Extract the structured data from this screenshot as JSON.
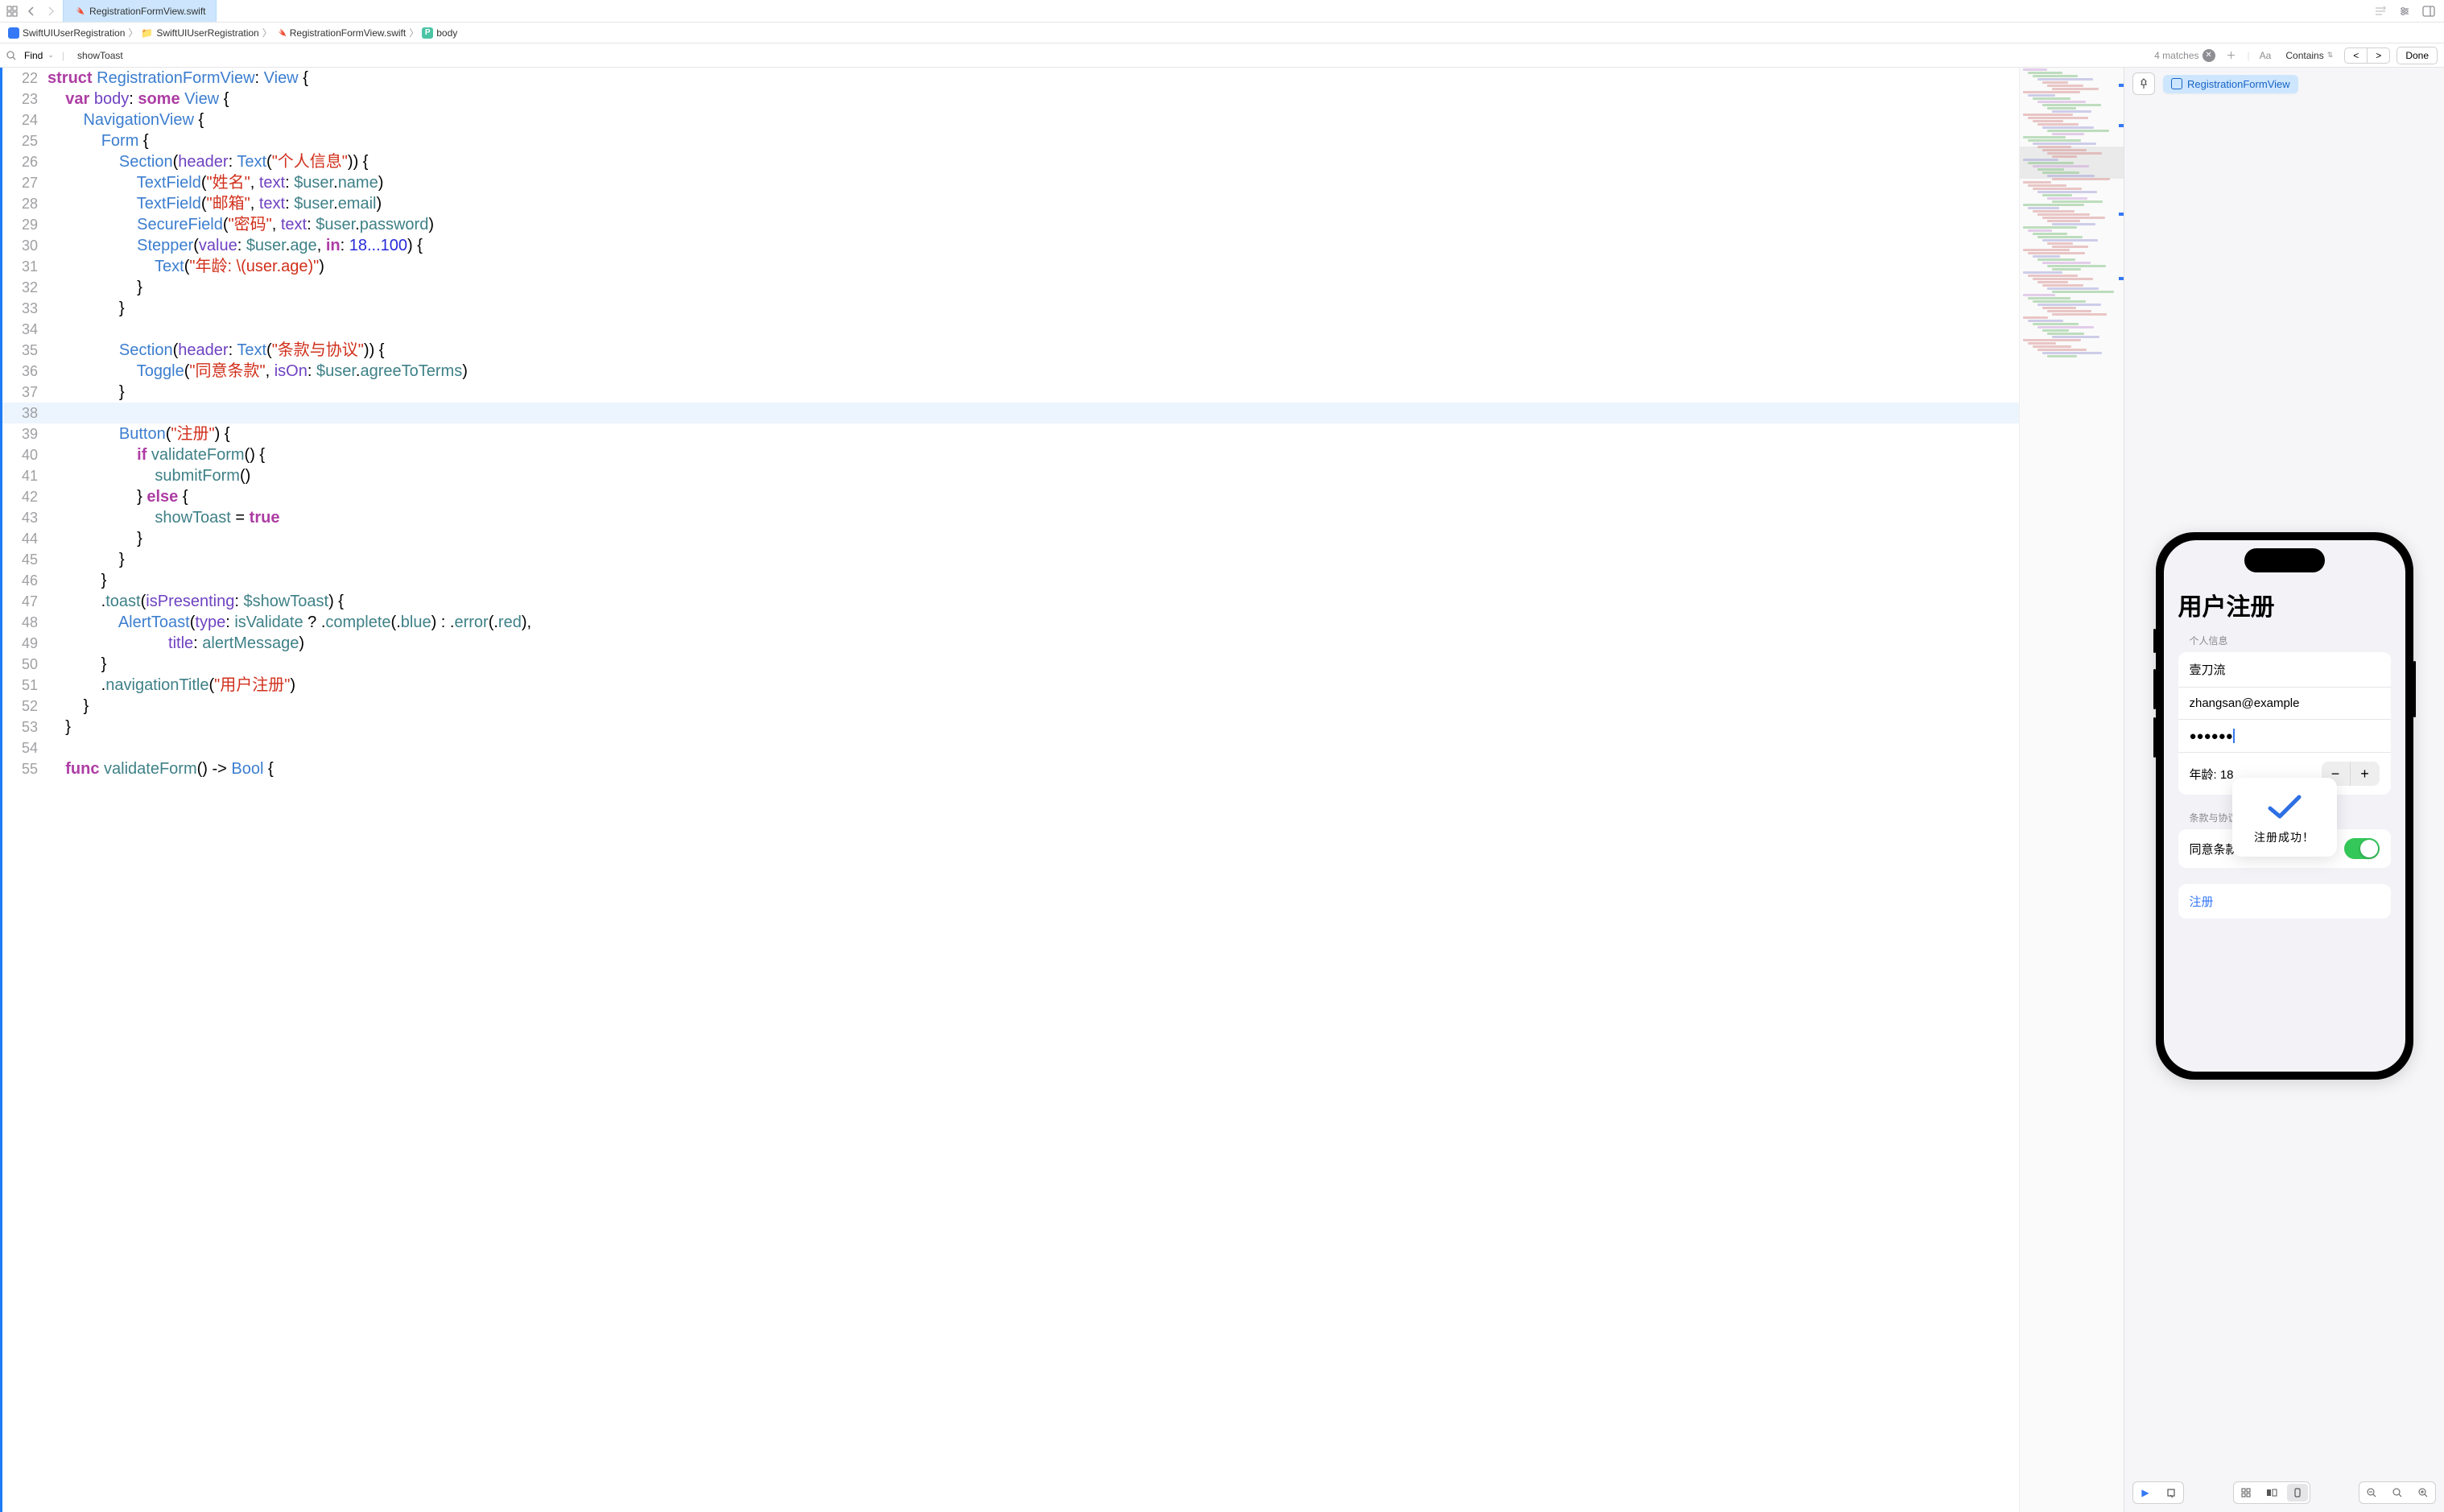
{
  "tab": {
    "filename": "RegistrationFormView.swift"
  },
  "breadcrumb": {
    "project": "SwiftUIUserRegistration",
    "folder": "SwiftUIUserRegistration",
    "file": "RegistrationFormView.swift",
    "symbol": "body",
    "symbol_badge": "P"
  },
  "find": {
    "mode": "Find",
    "term": "showToast",
    "matches": "4 matches",
    "contains": "Contains",
    "case_label": "Aa",
    "done": "Done"
  },
  "code_lines": [
    {
      "n": 22,
      "t": "struct RegistrationFormView: View {"
    },
    {
      "n": 23,
      "t": "    var body: some View {"
    },
    {
      "n": 24,
      "t": "        NavigationView {"
    },
    {
      "n": 25,
      "t": "            Form {"
    },
    {
      "n": 26,
      "t": "                Section(header: Text(\"个人信息\")) {"
    },
    {
      "n": 27,
      "t": "                    TextField(\"姓名\", text: $user.name)"
    },
    {
      "n": 28,
      "t": "                    TextField(\"邮箱\", text: $user.email)"
    },
    {
      "n": 29,
      "t": "                    SecureField(\"密码\", text: $user.password)"
    },
    {
      "n": 30,
      "t": "                    Stepper(value: $user.age, in: 18...100) {"
    },
    {
      "n": 31,
      "t": "                        Text(\"年龄: \\(user.age)\")"
    },
    {
      "n": 32,
      "t": "                    }"
    },
    {
      "n": 33,
      "t": "                }"
    },
    {
      "n": 34,
      "t": ""
    },
    {
      "n": 35,
      "t": "                Section(header: Text(\"条款与协议\")) {"
    },
    {
      "n": 36,
      "t": "                    Toggle(\"同意条款\", isOn: $user.agreeToTerms)"
    },
    {
      "n": 37,
      "t": "                }"
    },
    {
      "n": 38,
      "t": "",
      "hl": true
    },
    {
      "n": 39,
      "t": "                Button(\"注册\") {"
    },
    {
      "n": 40,
      "t": "                    if validateForm() {"
    },
    {
      "n": 41,
      "t": "                        submitForm()"
    },
    {
      "n": 42,
      "t": "                    } else {"
    },
    {
      "n": 43,
      "t": "                        showToast = true"
    },
    {
      "n": 44,
      "t": "                    }"
    },
    {
      "n": 45,
      "t": "                }"
    },
    {
      "n": 46,
      "t": "            }"
    },
    {
      "n": 47,
      "t": "            .toast(isPresenting: $showToast) {"
    },
    {
      "n": 48,
      "t": "                AlertToast(type: isValidate ? .complete(.blue) : .error(.red),"
    },
    {
      "n": 49,
      "t": "                           title: alertMessage)"
    },
    {
      "n": 50,
      "t": "            }"
    },
    {
      "n": 51,
      "t": "            .navigationTitle(\"用户注册\")"
    },
    {
      "n": 52,
      "t": "        }"
    },
    {
      "n": 53,
      "t": "    }"
    },
    {
      "n": 54,
      "t": ""
    },
    {
      "n": 55,
      "t": "    func validateForm() -> Bool {"
    }
  ],
  "line_start": 22,
  "preview": {
    "view_name": "RegistrationFormView",
    "app_title": "用户注册",
    "section1_label": "个人信息",
    "name_value": "壹刀流",
    "email_value": "zhangsan@example",
    "password_mask": "●●●●●●",
    "age_label": "年龄: 18",
    "section2_label": "条款与协议",
    "agree_label": "同意条款",
    "register_label": "注册",
    "toast_text": "注册成功！"
  }
}
